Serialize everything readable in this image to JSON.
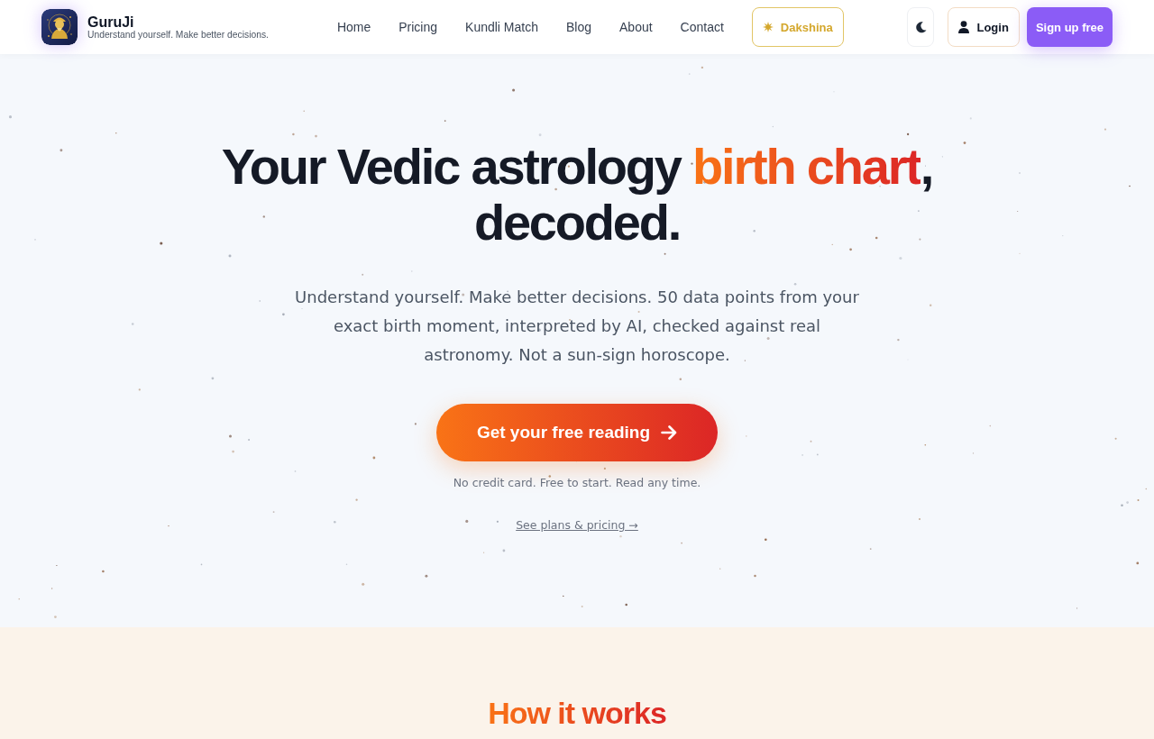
{
  "header": {
    "brand": {
      "name": "GuruJi",
      "tagline": "Understand yourself. Make better decisions."
    },
    "nav": [
      {
        "label": "Home"
      },
      {
        "label": "Pricing"
      },
      {
        "label": "Kundli Match"
      },
      {
        "label": "Blog"
      },
      {
        "label": "About"
      },
      {
        "label": "Contact"
      }
    ],
    "dakshina_button": "Dakshina",
    "login_button": "Login",
    "signup_button": "Sign up free"
  },
  "hero": {
    "headline": {
      "lead": "Your Vedic astrology ",
      "highlight": "birth chart",
      "tail": ", decoded."
    },
    "subtitle": "Understand yourself. Make better decisions. 50 data points from your exact birth moment, interpreted by AI, checked against real astronomy. Not a sun-sign horoscope.",
    "cta": "Get your free reading",
    "note": "No credit card. Free to start. Read any time.",
    "pricing_link": "See plans & pricing →"
  },
  "how_it_works": {
    "title": "How it works"
  }
}
